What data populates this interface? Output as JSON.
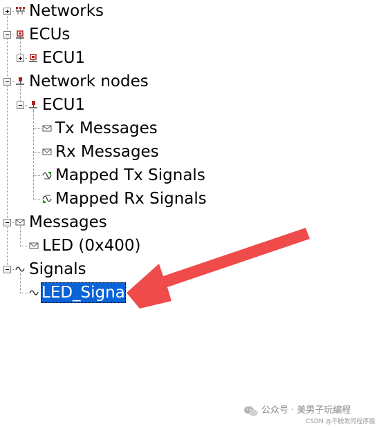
{
  "tree": {
    "networks": {
      "label": "Networks",
      "expanded": false,
      "icon": "network-icon"
    },
    "ecus": {
      "label": "ECUs",
      "expanded": true,
      "icon": "ecu-icon",
      "children": [
        {
          "label": "ECU1",
          "expanded": false,
          "icon": "ecu-icon"
        }
      ]
    },
    "network_nodes": {
      "label": "Network nodes",
      "expanded": true,
      "icon": "node-icon",
      "children": [
        {
          "label": "ECU1",
          "expanded": true,
          "icon": "node-icon",
          "children": [
            {
              "label": "Tx Messages",
              "icon": "message-icon"
            },
            {
              "label": "Rx Messages",
              "icon": "message-icon"
            },
            {
              "label": "Mapped Tx Signals",
              "icon": "mapped-tx-icon"
            },
            {
              "label": "Mapped Rx Signals",
              "icon": "mapped-rx-icon"
            }
          ]
        }
      ]
    },
    "messages": {
      "label": "Messages",
      "expanded": true,
      "icon": "message-icon",
      "children": [
        {
          "label": "LED (0x400)",
          "icon": "message-icon"
        }
      ]
    },
    "signals": {
      "label": "Signals",
      "expanded": true,
      "icon": "signal-icon",
      "children": [
        {
          "label": "LED_Signa",
          "icon": "signal-icon",
          "selected": true
        }
      ]
    }
  },
  "annotation": {
    "color": "#ef4b4b"
  },
  "watermark": {
    "main": "公众号 · 美男子玩编程",
    "sub": "CSDN @不脱发的程序猿"
  },
  "colors": {
    "selection": "#0a64d8",
    "ecu_icon": "#b02020",
    "connector": "#8a8a8a"
  }
}
